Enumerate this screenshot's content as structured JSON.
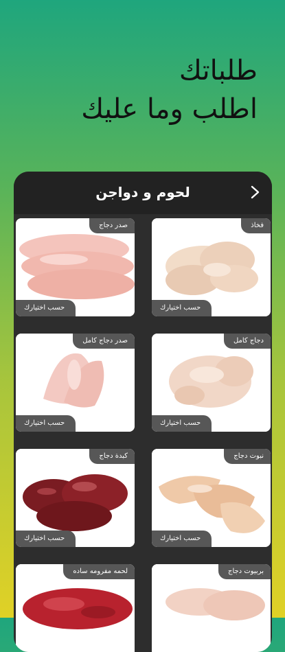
{
  "headline": {
    "line1": "طلباتك",
    "line2": "اطلب وما عليك"
  },
  "screen": {
    "title": "لحوم و دواجن",
    "back_icon": "chevron-right-icon"
  },
  "products": [
    {
      "name": "فخاذ",
      "action": "حسب اختيارك",
      "image": "chicken-thighs"
    },
    {
      "name": "صدر دجاج",
      "action": "حسب اختيارك",
      "image": "chicken-breast"
    },
    {
      "name": "دجاج كامل",
      "action": "حسب اختيارك",
      "image": "whole-chicken"
    },
    {
      "name": "صدر دجاج كامل",
      "action": "حسب اختيارك",
      "image": "whole-chicken-breast"
    },
    {
      "name": "نبوت دجاج",
      "action": "حسب اختيارك",
      "image": "chicken-drumsticks"
    },
    {
      "name": "كبدة دجاج",
      "action": "حسب اختيارك",
      "image": "chicken-liver"
    },
    {
      "name": "بربيوت دجاج",
      "action": "",
      "image": "boneless-chicken"
    },
    {
      "name": "لحمه مفرومه ساده",
      "action": "",
      "image": "minced-meat"
    }
  ]
}
